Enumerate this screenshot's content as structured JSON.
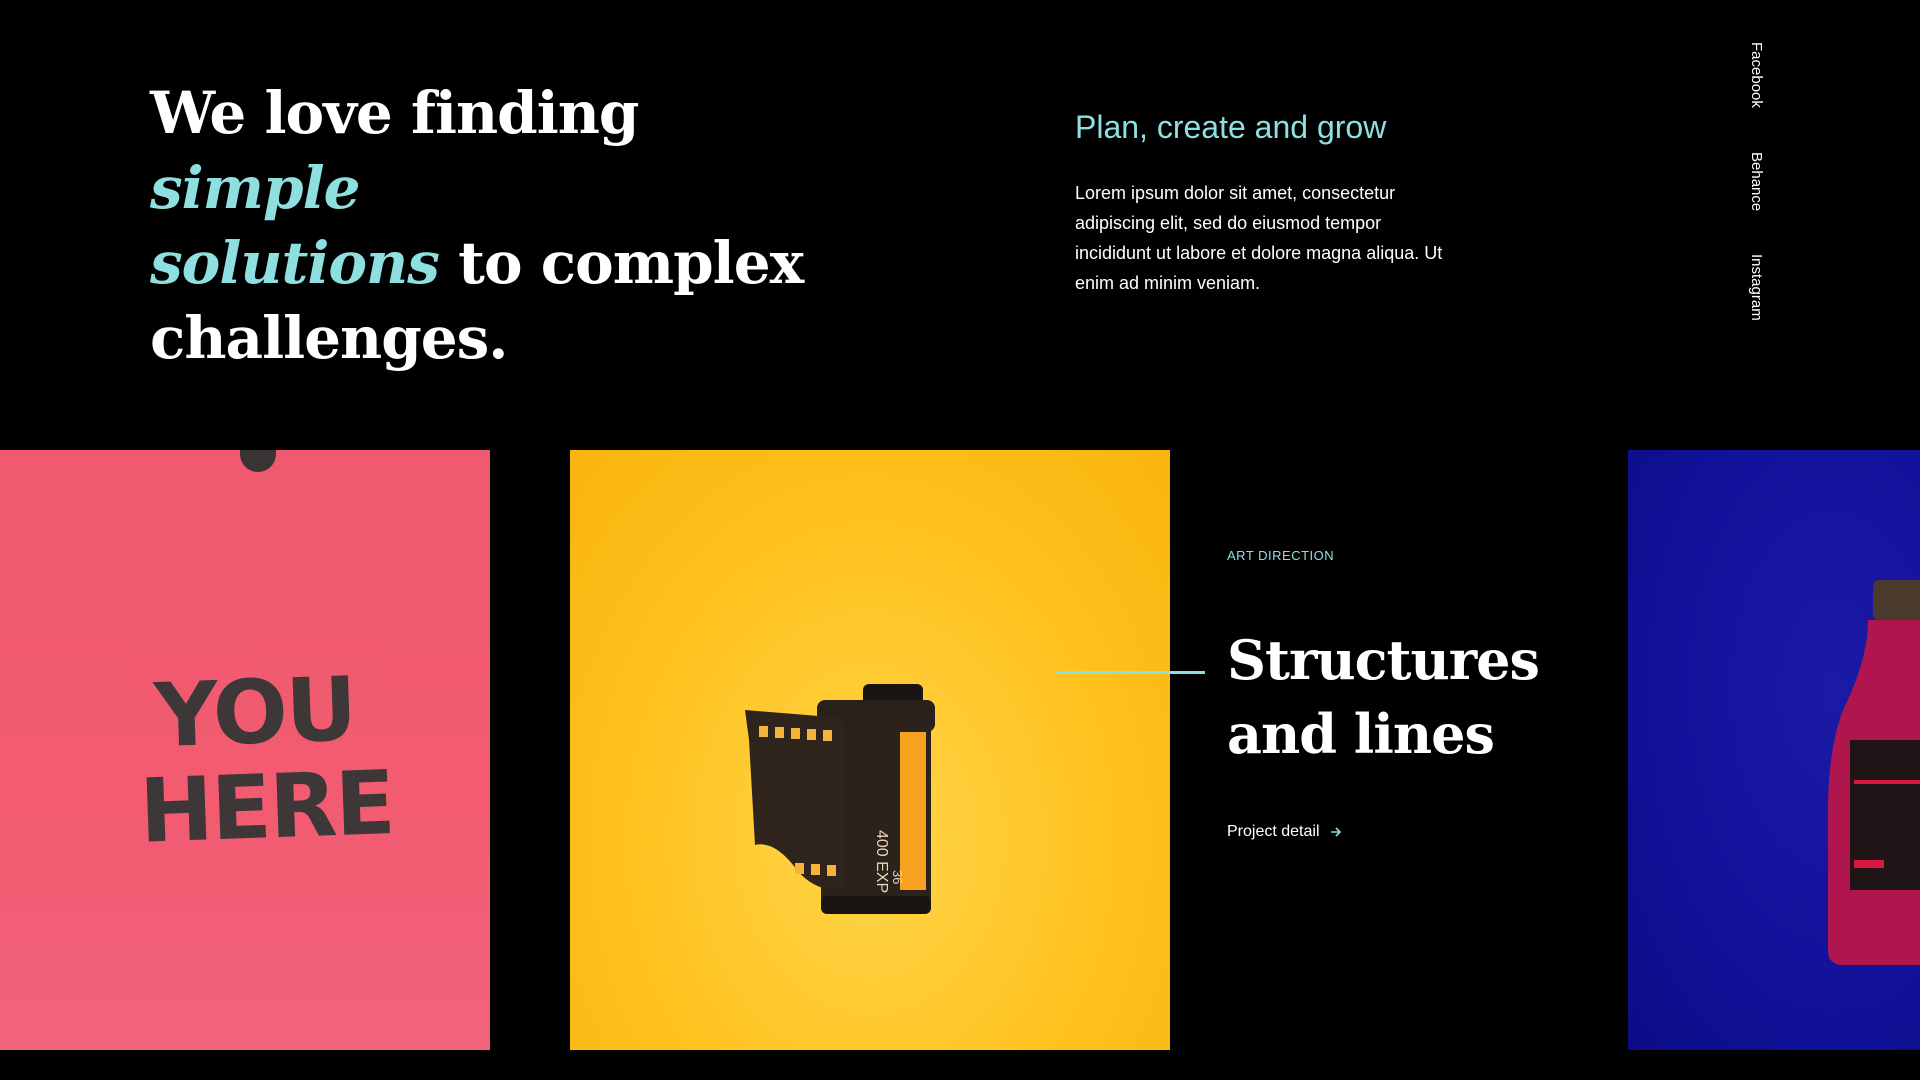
{
  "hero": {
    "line1_prefix": "We love finding ",
    "line1_accent": "simple",
    "line2_accent": "solutions",
    "line2_suffix": " to complex",
    "line3": "challenges."
  },
  "intro": {
    "title": "Plan, create and grow",
    "body": "Lorem ipsum dolor sit amet, consectetur adipiscing elit, sed do eiusmod tempor incididunt ut labore et dolore magna aliqua. Ut enim ad minim veniam."
  },
  "social": {
    "items": [
      "Facebook",
      "Behance",
      "Instagram"
    ]
  },
  "gallery": {
    "card1_text_line1": "YOU",
    "card1_text_line2": "HERE",
    "film_label": "400 EXP",
    "film_count": "36",
    "project": {
      "category": "ART DIRECTION",
      "title_line1": "Structures",
      "title_line2": "and lines",
      "link_label": "Project detail",
      "link_icon": "arrow-right-icon"
    }
  },
  "colors": {
    "background": "#000000",
    "accent": "#8ee0e0",
    "pink": "#f25b70",
    "yellow": "#ffc21f",
    "blue": "#11119a"
  }
}
